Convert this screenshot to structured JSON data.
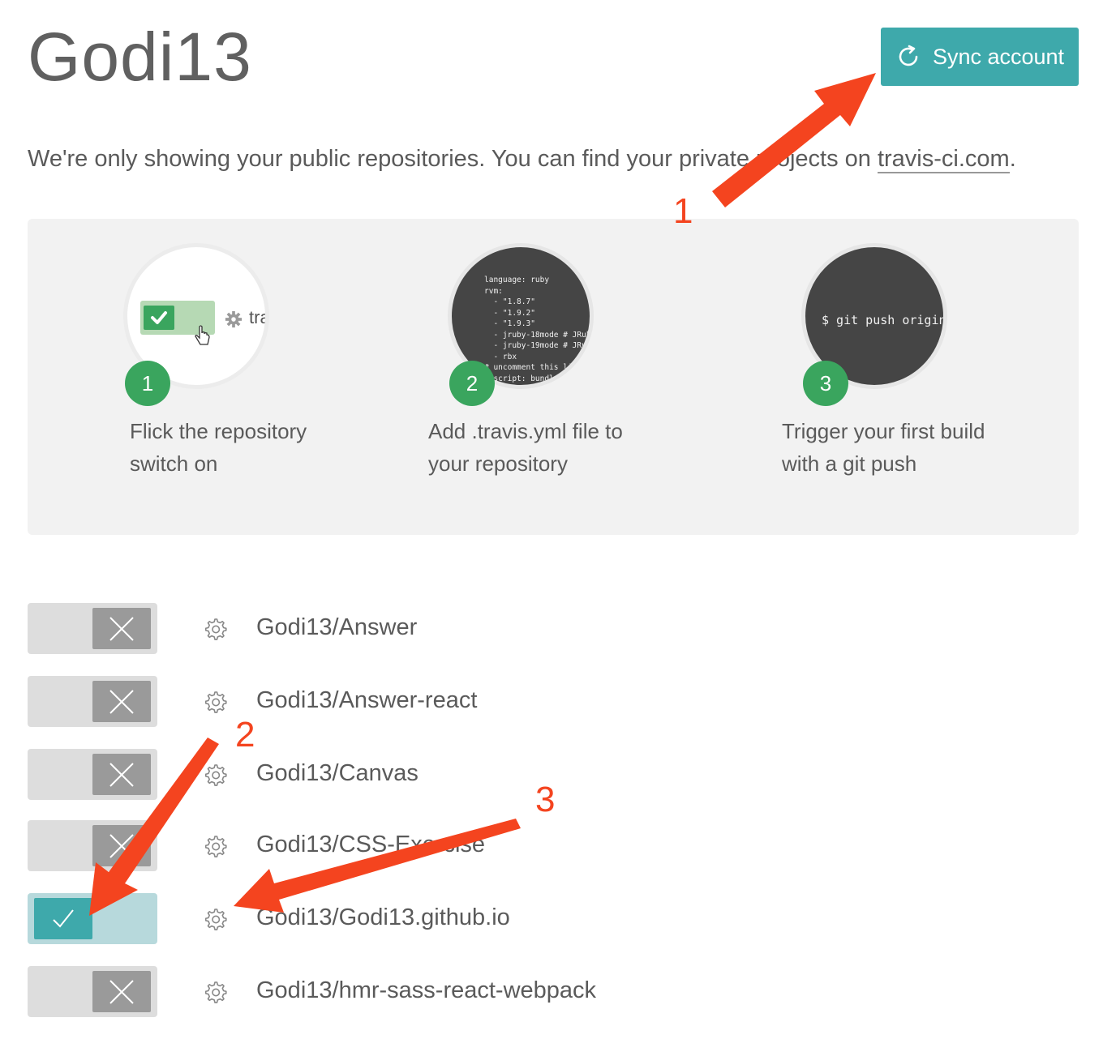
{
  "page": {
    "title": "Godi13",
    "sync_button": {
      "label": "Sync account",
      "icon": "sync-icon"
    },
    "notice": {
      "prefix": "We're only showing your public repositories. You can find your private projects on ",
      "link": "travis-ci.com",
      "suffix": "."
    }
  },
  "steps": [
    {
      "number": "1",
      "text": "Flick the repository switch on",
      "illustration_text": "tra"
    },
    {
      "number": "2",
      "text": "Add .travis.yml file to your repository",
      "code": "language: ruby\nrvm:\n  - \"1.8.7\"\n  - \"1.9.2\"\n  - \"1.9.3\"\n  - jruby-18mode # JRuby\n  - jruby-19mode # JRuby\n  - rbx\n# uncomment this line\n# script: bundle"
    },
    {
      "number": "3",
      "text": "Trigger your first build with a git push",
      "code": "$ git push origin"
    }
  ],
  "repositories": [
    {
      "name": "Godi13/Answer",
      "enabled": false
    },
    {
      "name": "Godi13/Answer-react",
      "enabled": false
    },
    {
      "name": "Godi13/Canvas",
      "enabled": false
    },
    {
      "name": "Godi13/CSS-Exercise",
      "enabled": false
    },
    {
      "name": "Godi13/Godi13.github.io",
      "enabled": true
    },
    {
      "name": "Godi13/hmr-sass-react-webpack",
      "enabled": false
    }
  ],
  "annotations": [
    "1",
    "2",
    "3"
  ],
  "colors": {
    "accent": "#3ea9ab",
    "success": "#3aa55e",
    "annotation": "#f4441f",
    "toggle_off": "#dddddd",
    "toggle_on": "#b7d9dc"
  }
}
